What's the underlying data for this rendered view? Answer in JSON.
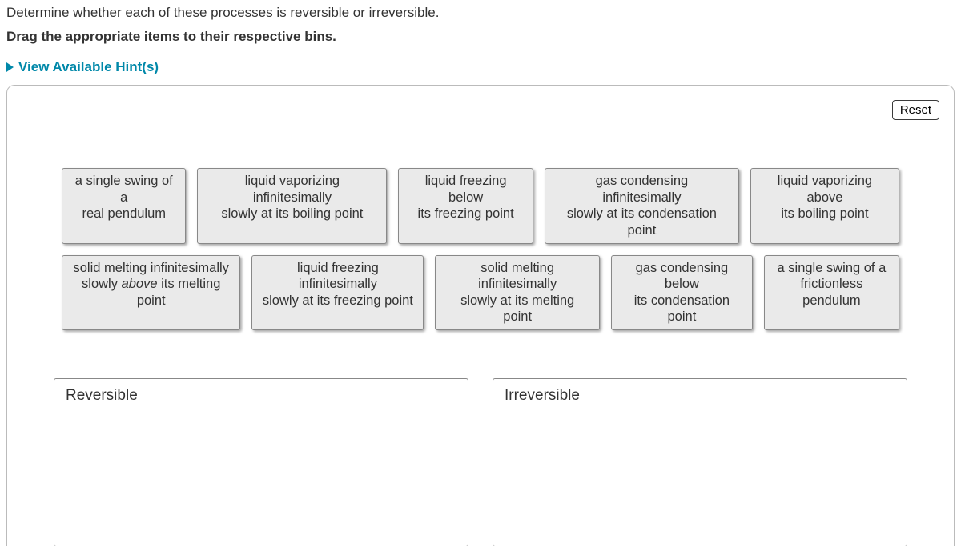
{
  "question": "Determine whether each of these processes is reversible or irreversible.",
  "instruction": "Drag the appropriate items to their respective bins.",
  "hints_label": "View Available Hint(s)",
  "buttons": {
    "reset": "Reset"
  },
  "items": {
    "row1": [
      "a single swing of a\nreal pendulum",
      "liquid vaporizing infinitesimally\nslowly at its boiling point",
      "liquid freezing below\nits freezing point",
      "gas condensing infinitesimally\nslowly at its condensation point",
      "liquid vaporizing above\nits boiling point"
    ],
    "row2": [
      "solid melting infinitesimally\nslowly above its melting point",
      "liquid freezing infinitesimally\nslowly at its freezing point",
      "solid melting infinitesimally\nslowly at its melting point",
      "gas condensing below\nits condensation point",
      "a single swing of a\nfrictionless pendulum"
    ]
  },
  "bins": {
    "reversible": "Reversible",
    "irreversible": "Irreversible"
  }
}
